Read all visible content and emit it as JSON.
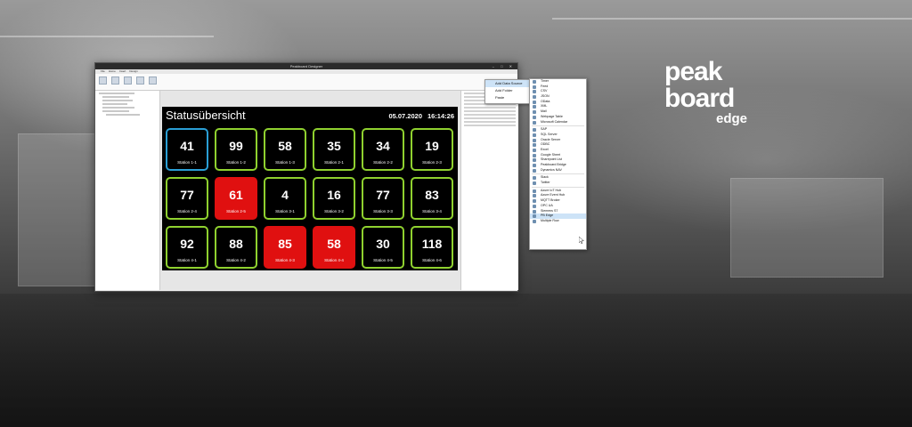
{
  "brand": {
    "name": "peakboard",
    "edition": "edge"
  },
  "window": {
    "title": "Peakboard Designer",
    "ribbon_tabs": [
      "File",
      "Home",
      "Insert",
      "Design"
    ],
    "controls": "– □ ✕"
  },
  "dashboard": {
    "title": "Statusübersicht",
    "date": "05.07.2020",
    "time": "16:14:26",
    "stations": [
      {
        "value": "41",
        "label": "Station 1-1",
        "state": "blue"
      },
      {
        "value": "99",
        "label": "Station 1-2",
        "state": "ok"
      },
      {
        "value": "58",
        "label": "Station 1-3",
        "state": "ok"
      },
      {
        "value": "35",
        "label": "Station 2-1",
        "state": "ok"
      },
      {
        "value": "34",
        "label": "Station 2-2",
        "state": "ok"
      },
      {
        "value": "19",
        "label": "Station 2-3",
        "state": "ok"
      },
      {
        "value": "77",
        "label": "Station 2-4",
        "state": "ok"
      },
      {
        "value": "61",
        "label": "Station 2-5",
        "state": "alarm"
      },
      {
        "value": "4",
        "label": "Station 3-1",
        "state": "ok"
      },
      {
        "value": "16",
        "label": "Station 3-2",
        "state": "ok"
      },
      {
        "value": "77",
        "label": "Station 3-3",
        "state": "ok"
      },
      {
        "value": "83",
        "label": "Station 3-4",
        "state": "ok"
      },
      {
        "value": "92",
        "label": "Station 4-1",
        "state": "ok"
      },
      {
        "value": "88",
        "label": "Station 4-2",
        "state": "ok"
      },
      {
        "value": "85",
        "label": "Station 4-3",
        "state": "alarm"
      },
      {
        "value": "58",
        "label": "Station 4-4",
        "state": "alarm"
      },
      {
        "value": "30",
        "label": "Station 4-5",
        "state": "ok"
      },
      {
        "value": "118",
        "label": "Station 4-6",
        "state": "ok"
      }
    ]
  },
  "context_menu": {
    "items": [
      "Add Data Source",
      "Add Folder",
      "Paste"
    ]
  },
  "data_source_menu": {
    "items": [
      "Timer",
      "Feed",
      "CSV",
      "JSON",
      "OData",
      "XML",
      "Mail",
      "Webpage Table",
      "Microsoft Calendar",
      "SAP",
      "SQL Server",
      "Oracle Server",
      "ODBC",
      "Excel",
      "Google Sheet",
      "Sharepoint List",
      "Peakboard Bridge",
      "Dynamics NAV",
      "Slack",
      "Twitter",
      "Azure IoT Hub",
      "Azure Event Hub",
      "MQTT Broker",
      "OPC UA",
      "Siemens S7",
      "PB Edge",
      "Multiple Row"
    ],
    "highlighted": "PB Edge"
  },
  "colors": {
    "ok": "#8fd12f",
    "alarm": "#e01010",
    "selected": "#2a9fd6"
  }
}
